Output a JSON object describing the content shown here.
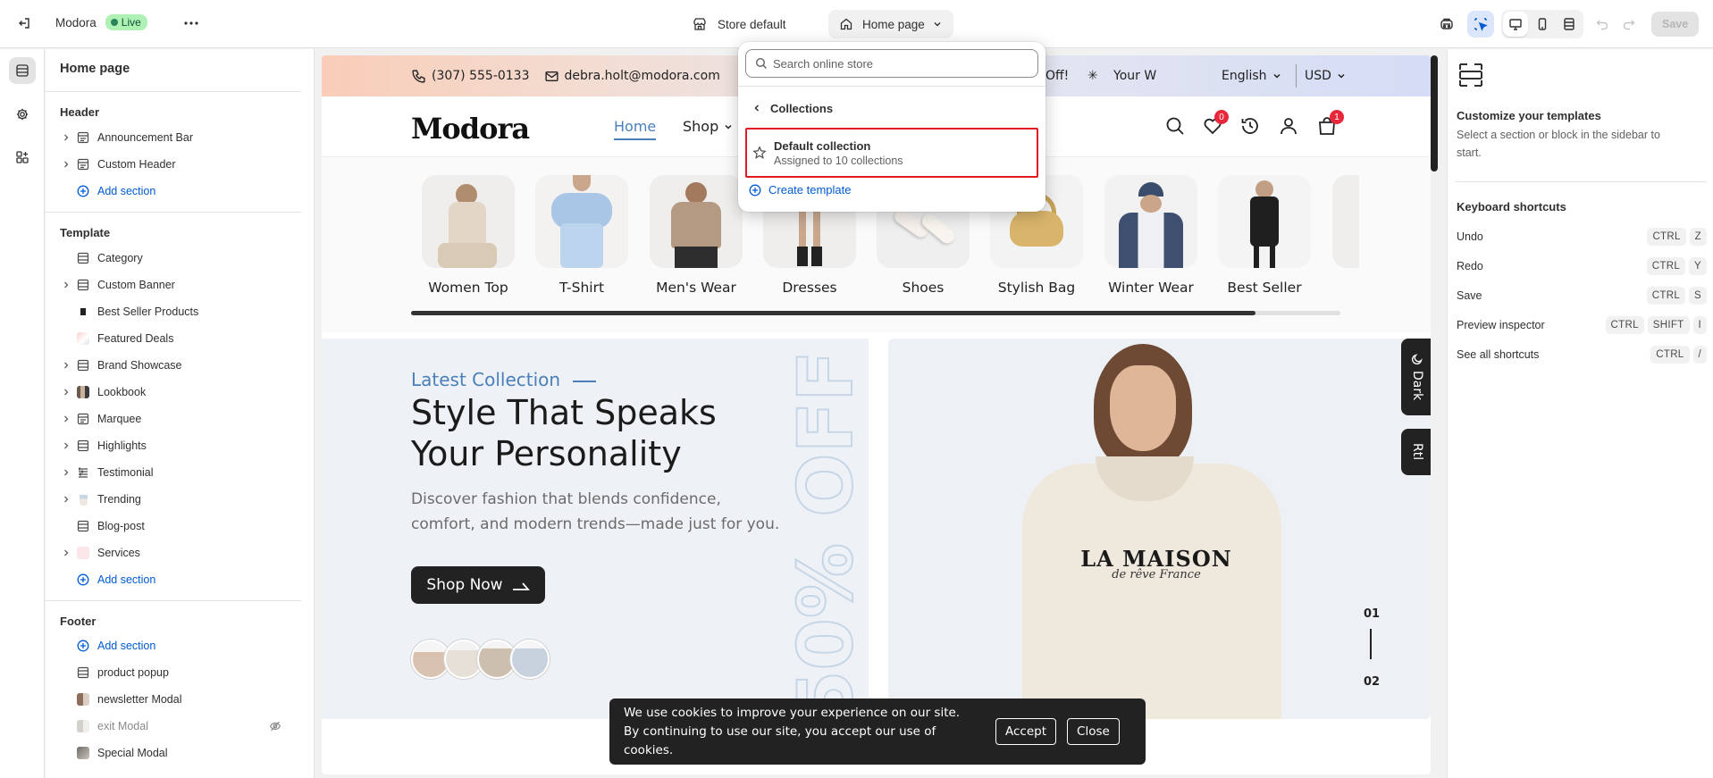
{
  "topbar": {
    "store_name": "Modora",
    "status_badge": "Live",
    "store_default": "Store default",
    "page_selector": "Home page",
    "save_label": "Save"
  },
  "sidebar": {
    "title": "Home page",
    "groups": {
      "header": "Header",
      "template": "Template",
      "footer": "Footer"
    },
    "header_items": [
      "Announcement Bar",
      "Custom Header"
    ],
    "template_items": [
      "Category",
      "Custom Banner",
      "Best Seller Products",
      "Featured Deals",
      "Brand Showcase",
      "Lookbook",
      "Marquee",
      "Highlights",
      "Testimonial",
      "Trending",
      "Blog-post",
      "Services"
    ],
    "footer_items": [
      "product popup",
      "newsletter Modal",
      "exit Modal",
      "Special Modal"
    ],
    "add_section": "Add section"
  },
  "popover": {
    "search_placeholder": "Search online store",
    "back_label": "Collections",
    "item_title": "Default collection",
    "item_subtitle": "Assigned to 10 collections",
    "create_label": "Create template"
  },
  "preview": {
    "announcement": {
      "phone": "(307) 555-0133",
      "email": "debra.holt@modora.com",
      "marquee_a": "Off!",
      "marquee_b": "Your W",
      "language": "English",
      "currency": "USD"
    },
    "logo": "Modora",
    "nav": [
      "Home",
      "Shop"
    ],
    "wishlist_count": "0",
    "cart_count": "1",
    "categories": [
      "Women Top",
      "T-Shirt",
      "Men's Wear",
      "Dresses",
      "Shoes",
      "Stylish Bag",
      "Winter Wear",
      "Best Seller"
    ],
    "hero": {
      "eyebrow": "Latest Collection",
      "headline": "Style That Speaks Your Personality",
      "description": "Discover fashion that blends confidence, comfort, and modern trends—made just for you.",
      "cta": "Shop Now",
      "vertical_text": "50% OFF",
      "hoodie_text_1": "LA MAISON",
      "hoodie_text_2": "de rêve France",
      "slide_current": "01",
      "slide_next": "02"
    },
    "dark_toggle": "Dark",
    "rtl_toggle": "Rtl",
    "cookie": {
      "message": "We use cookies to improve your experience on our site. By continuing to use our site, you accept our use of cookies.",
      "accept": "Accept",
      "close": "Close"
    }
  },
  "right_panel": {
    "title": "Customize your templates",
    "subtitle": "Select a section or block in the sidebar to start.",
    "shortcuts_title": "Keyboard shortcuts",
    "shortcuts": [
      {
        "label": "Undo",
        "keys": [
          "CTRL",
          "Z"
        ]
      },
      {
        "label": "Redo",
        "keys": [
          "CTRL",
          "Y"
        ]
      },
      {
        "label": "Save",
        "keys": [
          "CTRL",
          "S"
        ]
      },
      {
        "label": "Preview inspector",
        "keys": [
          "CTRL",
          "SHIFT",
          "I"
        ]
      },
      {
        "label": "See all shortcuts",
        "keys": [
          "CTRL",
          "/"
        ]
      }
    ]
  },
  "colors": {
    "accent_blue": "#005bd3",
    "live_green": "#aff0b5",
    "highlight_red": "#e01b24",
    "hero_blue": "#4a7fb9"
  }
}
